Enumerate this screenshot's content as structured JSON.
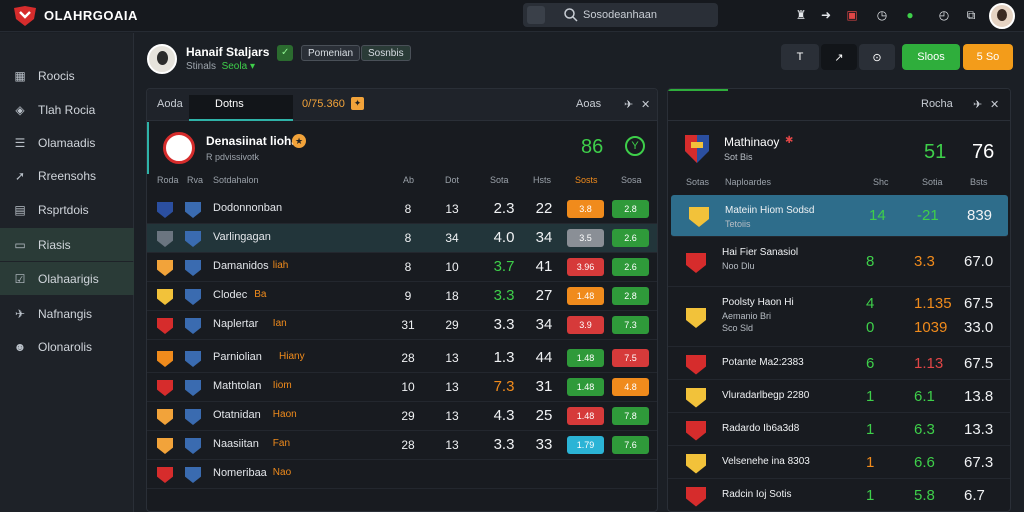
{
  "app": {
    "brand": "OLAHRGOAIA"
  },
  "search": {
    "placeholder": "Sosodeanhaan"
  },
  "sidebar": {
    "items": [
      {
        "label": "Roocis",
        "icon": "grid-icon"
      },
      {
        "label": "Tlah Rocia",
        "icon": "shield-icon"
      },
      {
        "label": "Olamaadis",
        "icon": "list-icon"
      },
      {
        "label": "Rreensohs",
        "icon": "arrow-icon"
      },
      {
        "label": "Rsprtdois",
        "icon": "grid-icon"
      },
      {
        "label": "Riasis",
        "icon": "square-icon"
      },
      {
        "label": "Olahaarigis",
        "icon": "checkbox-icon"
      },
      {
        "label": "Nafnangis",
        "icon": "plane-icon"
      },
      {
        "label": "Olonarolis",
        "icon": "user-icon"
      }
    ]
  },
  "user": {
    "name": "Hanaif Staljars",
    "sub_label": "Stinals",
    "sub_value": "Seola",
    "chip1": "Pomenian",
    "chip2": "Sosnbis"
  },
  "toolbar": {
    "btn1": "T",
    "btn2": "↗",
    "btn3": "⊙",
    "btn_green": "Sloos",
    "btn_orange": "5 So"
  },
  "left_panel": {
    "tab1": "Aoda",
    "tab2": "Dotns",
    "tab3": "0/75.360",
    "right_label": "Aoas",
    "featured": {
      "name": "Denasiinat liohan",
      "sub": "R pdvissivotk",
      "score1": "86",
      "score2": "Y"
    },
    "headers": [
      "Roda",
      "Rva",
      "Sotdahalon",
      "Ab",
      "Dot",
      "Sota",
      "Hsts",
      "Sosts",
      "Sosa"
    ],
    "rows": [
      {
        "name": "Dodonnonban",
        "tag": "",
        "a": "8",
        "b": "13",
        "c": "2.3",
        "d": "22",
        "o1": "3.8",
        "o1c": "#f08b1c",
        "o2": "2.8",
        "o2c": "#2f9a3a"
      },
      {
        "name": "Varlingagan",
        "tag": "",
        "a": "8",
        "b": "34",
        "c": "4.0",
        "d": "34",
        "o1": "3.5",
        "o1c": "#8a8f96",
        "o2": "2.6",
        "o2c": "#2f9a3a"
      },
      {
        "name": "Damanidos",
        "tag": "liah",
        "a": "8",
        "b": "10",
        "c": "3.7",
        "d": "41",
        "o1": "3.96",
        "o1c": "#d63a3a",
        "o2": "2.6",
        "o2c": "#2f9a3a"
      },
      {
        "name": "Clodec",
        "tag": "Ba",
        "a": "9",
        "b": "18",
        "c": "3.3",
        "d": "27",
        "o1": "1.48",
        "o1c": "#f08b1c",
        "o2": "2.8",
        "o2c": "#2f9a3a"
      },
      {
        "name": "Naplertar",
        "tag": "Ian",
        "a": "31",
        "b": "29",
        "c": "3.3",
        "d": "34",
        "o1": "3.9",
        "o1c": "#d63a3a",
        "o2": "7.3",
        "o2c": "#2f9a3a"
      },
      {
        "name": "Parniolian",
        "tag": "Hiany",
        "a": "28",
        "b": "13",
        "c": "1.3",
        "d": "44",
        "o1": "1.48",
        "o1c": "#2f9a3a",
        "o2": "7.5",
        "o2c": "#d63a3a"
      },
      {
        "name": "Mathtolan",
        "tag": "Iiom",
        "a": "10",
        "b": "13",
        "c": "7.3",
        "d": "31",
        "o1": "1.48",
        "o1c": "#2f9a3a",
        "o2": "4.8",
        "o2c": "#f08b1c"
      },
      {
        "name": "Otatnidan",
        "tag": "Haon",
        "a": "29",
        "b": "13",
        "c": "4.3",
        "d": "25",
        "o1": "1.48",
        "o1c": "#d63a3a",
        "o2": "7.8",
        "o2c": "#2f9a3a"
      },
      {
        "name": "Naasiitan",
        "tag": "Fan",
        "a": "28",
        "b": "13",
        "c": "3.3",
        "d": "33",
        "o1": "1.79",
        "o1c": "#2bb4d6",
        "o2": "7.6",
        "o2c": "#2f9a3a"
      },
      {
        "name": "Nomeribaa",
        "tag": "Nao",
        "a": "",
        "b": "",
        "c": "",
        "d": "",
        "o1": "",
        "o1c": "",
        "o2": "",
        "o2c": ""
      }
    ]
  },
  "right_panel": {
    "tab": "Rocha",
    "featured": {
      "name": "Mathinaoy",
      "sub": "Sot Bis",
      "v1": "51",
      "v2": "76"
    },
    "headers": [
      "Sotas",
      "Naploardes",
      "Shc",
      "Sotia",
      "Bsts"
    ],
    "rows": [
      {
        "name": "Mateiin Hiom Sodsd",
        "sub": "Tetoiis",
        "c1": "14",
        "c2": "-21",
        "c3": "839",
        "c1c": "#3ecf4a",
        "c2c": "#3ecf4a",
        "sel": true
      },
      {
        "name": "Hai Fier Sanasiol",
        "sub": "Noo Dlu",
        "c1": "8",
        "c2": "3.3",
        "c3": "67.0",
        "c1c": "#3ecf4a",
        "c2c": "#f08b1c",
        "sel": false
      },
      {
        "name": "Poolsty Haon Hi",
        "sub": "Aemanio Bri",
        "sub2": "Sco Sld",
        "c1": "4",
        "c2": "1.135",
        "c3": "67.5",
        "c1b": "0",
        "c2b": "1039",
        "c3b": "33.0",
        "c1c": "#3ecf4a",
        "c2c": "#f08b1c",
        "sel": false
      },
      {
        "name": "Potante Ma2:2383",
        "sub": "",
        "c1": "6",
        "c2": "1.13",
        "c3": "67.5",
        "c1c": "#3ecf4a",
        "c2c": "#e04646",
        "sel": false
      },
      {
        "name": "Vluradarlbegp 2280",
        "sub": "",
        "c1": "1",
        "c2": "6.1",
        "c3": "13.8",
        "c1c": "#3ecf4a",
        "c2c": "#3ecf4a",
        "sel": false
      },
      {
        "name": "Radardo Ib6a3d8",
        "sub": "",
        "c1": "1",
        "c2": "6.3",
        "c3": "13.3",
        "c1c": "#3ecf4a",
        "c2c": "#3ecf4a",
        "sel": false
      },
      {
        "name": "Velsenehe ina 8303",
        "sub": "",
        "c1": "1",
        "c2": "6.6",
        "c3": "67.3",
        "c1c": "#f08b1c",
        "c2c": "#3ecf4a",
        "sel": false
      },
      {
        "name": "Radcin Ioj Sotis",
        "sub": "",
        "c1": "1",
        "c2": "5.8",
        "c3": "6.7",
        "c1c": "#3ecf4a",
        "c2c": "#3ecf4a",
        "sel": false
      }
    ]
  }
}
